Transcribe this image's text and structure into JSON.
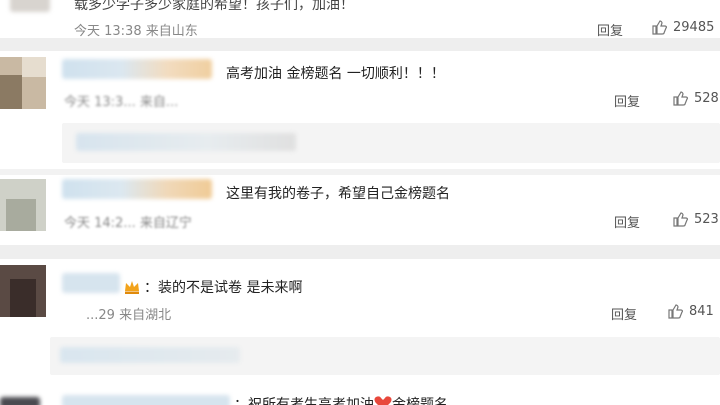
{
  "comments": [
    {
      "text": "载多少学子多少家庭的希望！孩子们，加油！",
      "meta": "今天 13:38 来自山东",
      "reply": "回复",
      "likes": "29485"
    },
    {
      "text": "高考加油 金榜题名 一切顺利！！！",
      "meta": "今天 13:3... 来自...",
      "reply": "回复",
      "likes": "528"
    },
    {
      "text": "这里有我的卷子，希望自己金榜题名",
      "meta": "今天 14:2... 来自辽宁",
      "reply": "回复",
      "likes": "523"
    },
    {
      "text": "：装的不是试卷 是未来啊",
      "meta": "...29 来自湖北",
      "reply": "回复",
      "likes": "841"
    },
    {
      "text_before": "：祝所有考生高考加油",
      "text_after": "金榜题名"
    }
  ],
  "icons": {
    "like": "thumbs-up-icon",
    "badge": "crown-badge-icon",
    "heart": "heart-icon"
  },
  "colors": {
    "accent_heart": "#e8483c",
    "badge": "#f2a31b",
    "separator": "#eeeeee"
  }
}
